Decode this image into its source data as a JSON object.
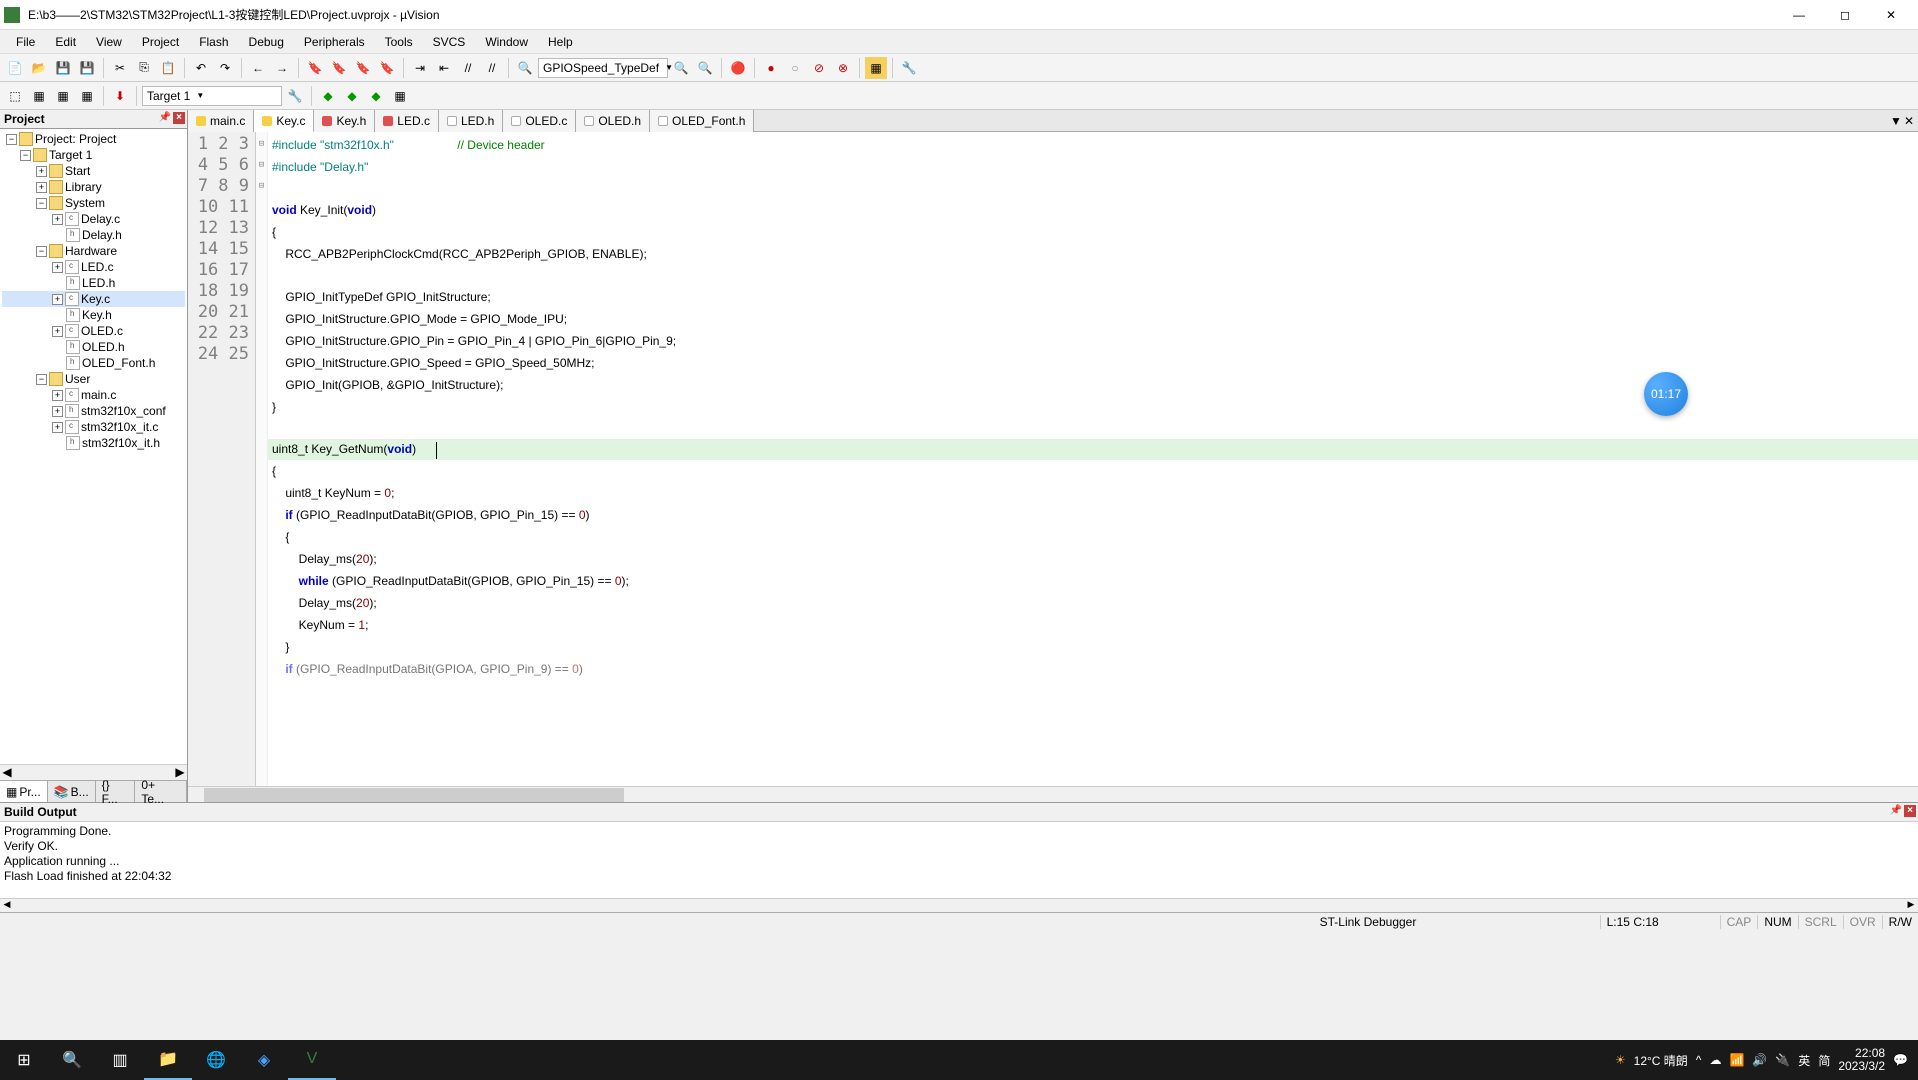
{
  "window": {
    "title": "E:\\b3——2\\STM32\\STM32Project\\L1-3按键控制LED\\Project.uvprojx - µVision"
  },
  "menu": [
    "File",
    "Edit",
    "View",
    "Project",
    "Flash",
    "Debug",
    "Peripherals",
    "Tools",
    "SVCS",
    "Window",
    "Help"
  ],
  "toolbar1": {
    "find_box": "GPIOSpeed_TypeDef"
  },
  "toolbar2": {
    "target_box": "Target 1"
  },
  "project_panel": {
    "title": "Project",
    "root": "Project: Project",
    "target": "Target 1",
    "groups": [
      {
        "name": "Start",
        "expanded": false
      },
      {
        "name": "Library",
        "expanded": false
      },
      {
        "name": "System",
        "expanded": true,
        "files": [
          "Delay.c",
          "Delay.h"
        ]
      },
      {
        "name": "Hardware",
        "expanded": true,
        "files": [
          "LED.c",
          "LED.h",
          "Key.c",
          "Key.h",
          "OLED.c",
          "OLED.h",
          "OLED_Font.h"
        ],
        "selected": "Key.c"
      },
      {
        "name": "User",
        "expanded": true,
        "files": [
          "main.c",
          "stm32f10x_conf",
          "stm32f10x_it.c",
          "stm32f10x_it.h"
        ]
      }
    ],
    "bottom_tabs": [
      "Pr...",
      "B...",
      "{} F...",
      "0+ Te..."
    ]
  },
  "editor": {
    "tabs": [
      {
        "name": "main.c",
        "color": "yellow"
      },
      {
        "name": "Key.c",
        "color": "yellow",
        "active": true
      },
      {
        "name": "Key.h",
        "color": "red"
      },
      {
        "name": "LED.c",
        "color": "red"
      },
      {
        "name": "LED.h",
        "color": "white"
      },
      {
        "name": "OLED.c",
        "color": "white"
      },
      {
        "name": "OLED.h",
        "color": "white"
      },
      {
        "name": "OLED_Font.h",
        "color": "white"
      }
    ],
    "badge": "01:17",
    "status_pos": "L:15 C:18"
  },
  "code_lines": {
    "l1a": "#include ",
    "l1b": "\"stm32f10x.h\"",
    "l1c": "                   // Device header",
    "l2a": "#include ",
    "l2b": "\"Delay.h\"",
    "l4a": "void",
    "l4b": " Key_Init(",
    "l4c": "void",
    "l4d": ")",
    "l5": "{",
    "l6": "    RCC_APB2PeriphClockCmd(RCC_APB2Periph_GPIOB, ENABLE);",
    "l8": "    GPIO_InitTypeDef GPIO_InitStructure;",
    "l9": "    GPIO_InitStructure.GPIO_Mode = GPIO_Mode_IPU;",
    "l10": "    GPIO_InitStructure.GPIO_Pin = GPIO_Pin_4 | GPIO_Pin_6|GPIO_Pin_9;",
    "l11": "    GPIO_InitStructure.GPIO_Speed = GPIO_Speed_50MHz;",
    "l12": "    GPIO_Init(GPIOB, &GPIO_InitStructure);",
    "l13": "}",
    "l15a": "uint8_t Key_GetNum(",
    "l15b": "void",
    "l15c": ")",
    "l16": "{",
    "l17a": "    uint8_t KeyNum = ",
    "l17b": "0",
    "l17c": ";",
    "l18a": "    ",
    "l18b": "if",
    "l18c": " (GPIO_ReadInputDataBit(GPIOB, GPIO_Pin_15) == ",
    "l18d": "0",
    "l18e": ")",
    "l19": "    {",
    "l20a": "        Delay_ms(",
    "l20b": "20",
    "l20c": ");",
    "l21a": "        ",
    "l21b": "while",
    "l21c": " (GPIO_ReadInputDataBit(GPIOB, GPIO_Pin_15) == ",
    "l21d": "0",
    "l21e": ");",
    "l22a": "        Delay_ms(",
    "l22b": "20",
    "l22c": ");",
    "l23a": "        KeyNum = ",
    "l23b": "1",
    "l23c": ";",
    "l24": "    }",
    "l25a": "    ",
    "l25b": "if",
    "l25c": " (GPIO_ReadInputDataBit(GPIOA, GPIO_Pin_9) == ",
    "l25d": "0",
    "l25e": ")"
  },
  "build_output": {
    "title": "Build Output",
    "lines": [
      "Programming Done.",
      "Verify OK.",
      "Application running ...",
      "Flash Load finished at 22:04:32"
    ]
  },
  "statusbar": {
    "debugger": "ST-Link Debugger",
    "caps": "CAP",
    "num": "NUM",
    "scrl": "SCRL",
    "ovr": "OVR",
    "rw": "R/W"
  },
  "taskbar": {
    "weather": "12°C 晴朗",
    "ime_lang": "英",
    "ime_mode": "简",
    "time": "22:08",
    "date": "2023/3/2"
  }
}
